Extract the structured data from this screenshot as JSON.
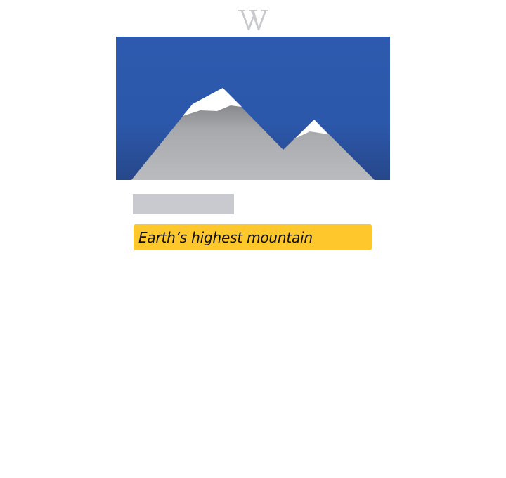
{
  "app": {
    "logo_icon": "wikipedia-w-icon"
  },
  "article": {
    "hero_image_icon": "mountain-illustration-icon",
    "title_placeholder": "",
    "description": "Earth’s highest mountain"
  },
  "colors": {
    "logo": "#c8c9cc",
    "sky_top": "#2d5aae",
    "sky_bottom": "#27478a",
    "mountain": "#b5b7ba",
    "snow": "#ffffff",
    "placeholder": "#c8cad0",
    "description_highlight": "#fec82d"
  }
}
